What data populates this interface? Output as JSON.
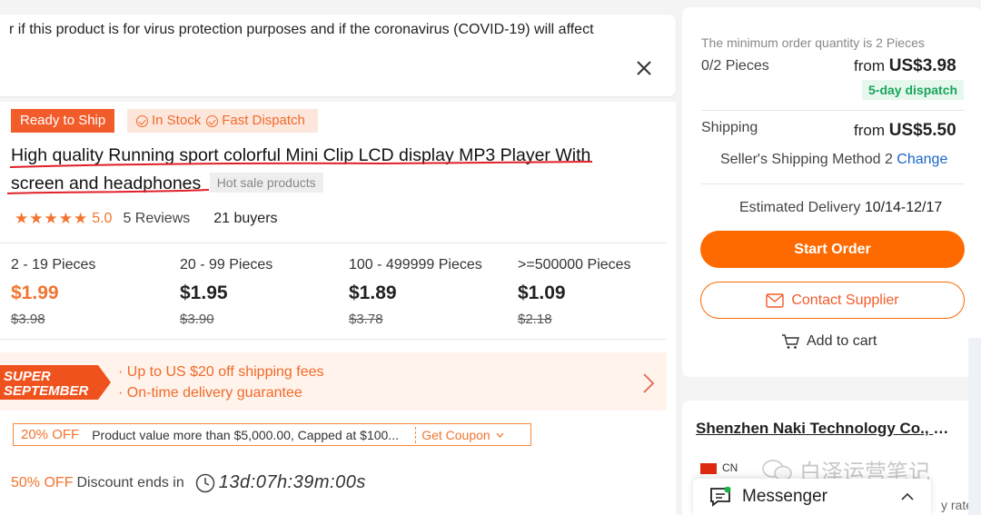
{
  "notice": {
    "text": "r if this product is for virus protection purposes and if the coronavirus (COVID-19) will affect"
  },
  "tags": {
    "ready": "Ready to Ship",
    "stock": "In Stock",
    "dispatch": "Fast Dispatch"
  },
  "product": {
    "title": "High quality Running sport colorful Mini Clip LCD display MP3 Player With screen and headphones",
    "hot_tag": "Hot sale products",
    "stars": "★★★★★",
    "rating": "5.0",
    "reviews": "5 Reviews",
    "buyers": "21 buyers"
  },
  "tiers": [
    {
      "range": "2 - 19 Pieces",
      "price": "$1.99",
      "old": "$3.98"
    },
    {
      "range": "20 - 99 Pieces",
      "price": "$1.95",
      "old": "$3.90"
    },
    {
      "range": "100 - 499999 Pieces",
      "price": "$1.89",
      "old": "$3.78"
    },
    {
      "range": ">=500000 Pieces",
      "price": "$1.09",
      "old": "$2.18"
    }
  ],
  "promo": {
    "logo_line1": "SUPER",
    "logo_line2": "SEPTEMBER",
    "line1": "· Up to US $20 off shipping fees",
    "line2": "· On-time delivery guarantee"
  },
  "coupon": {
    "off": "20% OFF",
    "desc": "Product value more than $5,000.00, Capped at $100...",
    "get": "Get Coupon"
  },
  "discount": {
    "off": "50% OFF",
    "text": "Discount ends in",
    "countdown": "13d:07h:39m:00s"
  },
  "order": {
    "min_order": "The minimum order quantity is 2 Pieces",
    "pieces": "0/2 Pieces",
    "from": "from",
    "price": "US$3.98",
    "dispatch": "5-day dispatch",
    "shipping_label": "Shipping",
    "ship_price": "US$5.50",
    "ship_method": "Seller's Shipping Method 2",
    "change": "Change",
    "est_label": "Estimated Delivery",
    "est_dates": "10/14-12/17",
    "start": "Start Order",
    "contact": "Contact Supplier",
    "add_cart": "Add to cart"
  },
  "supplier": {
    "name": "Shenzhen Naki Technology Co., L...",
    "country": "CN"
  },
  "messenger": {
    "label": "Messenger",
    "rate_fragment": "y rate"
  },
  "watermark": {
    "text": "白泽运营笔记"
  },
  "colors": {
    "accent": "#ff6a00",
    "promo_text": "#f06a2a",
    "link": "#1a66c8",
    "dispatch_green": "#19a55a",
    "underline_red": "#e0202a"
  }
}
